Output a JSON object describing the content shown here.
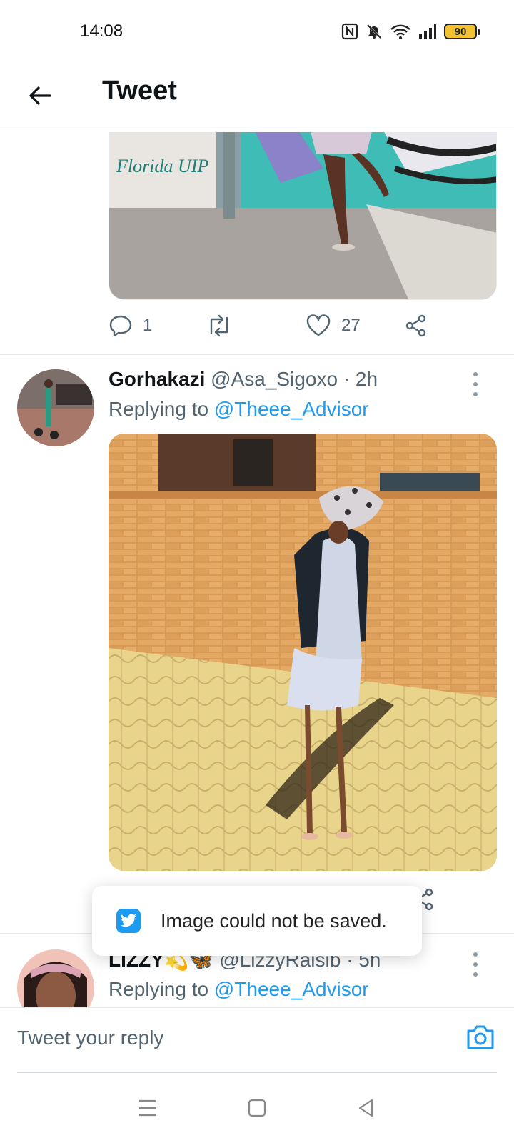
{
  "status_bar": {
    "time": "14:08",
    "battery": "90",
    "icons": [
      "nfc-icon",
      "mute-icon",
      "wifi-icon",
      "signal-icon",
      "battery-icon"
    ]
  },
  "header": {
    "title": "Tweet",
    "back_icon": "arrow-left-icon"
  },
  "previous_tweet": {
    "image_sign_text": "Florida UIP",
    "actions": {
      "reply_count": "1",
      "retweet_count": "",
      "like_count": "27"
    }
  },
  "tweet_2": {
    "name": "Gorhakazi",
    "handle": "@Asa_Sigoxo",
    "time": "· 2h",
    "replying_prefix": "Replying to ",
    "replying_mention": "@Theee_Advisor"
  },
  "tweet_3": {
    "name": "LIZZY",
    "emoji": "💫🦋",
    "handle": "@LizzyRaisib",
    "time": "· 5h",
    "replying_prefix": "Replying to ",
    "replying_mention": "@Theee_Advisor"
  },
  "toast": {
    "text": "Image could not be saved.",
    "icon": "twitter-bird-icon"
  },
  "reply_bar": {
    "placeholder": "Tweet your reply",
    "camera_icon": "camera-icon"
  },
  "nav_bar": {
    "icons": [
      "menu-icon",
      "home-square-icon",
      "back-triangle-icon"
    ]
  },
  "colors": {
    "accent": "#1d9bf0",
    "text_primary": "#0f1419",
    "text_secondary": "#536471",
    "divider": "#e6e9eb"
  }
}
